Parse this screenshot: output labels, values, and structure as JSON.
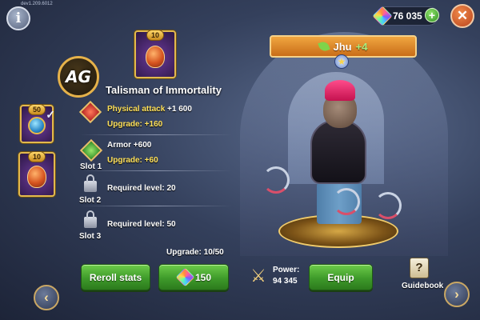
{
  "version": "dev1.209.6012",
  "top_bar": {
    "currency_value": "76 035",
    "currency_icon": "gem-icon",
    "plus_label": "+",
    "close_label": "✕",
    "info_label": "i"
  },
  "logo": {
    "text": "AG"
  },
  "item_cards": [
    {
      "level": "10",
      "icon": "talisman-heart-icon"
    },
    {
      "level": "50",
      "icon": "amulet-gem-icon",
      "equipped": true
    },
    {
      "level": "10",
      "icon": "talisman-heart-icon"
    }
  ],
  "item_panel": {
    "title": "Talisman of Immortality",
    "stats": [
      {
        "label": "Physical attack",
        "value": "+1 600",
        "upgrade": "Upgrade: +160",
        "icon": "attack-diamond-icon",
        "slot": ""
      },
      {
        "label": "Armor",
        "value": "+600",
        "upgrade": "Upgrade: +60",
        "icon": "armor-diamond-icon",
        "slot": "Slot 1"
      },
      {
        "label": "Required level: 20",
        "slot": "Slot 2",
        "icon": "lock-icon"
      },
      {
        "label": "Required level: 50",
        "slot": "Slot 3",
        "icon": "lock-icon"
      }
    ],
    "upgrade_count": "Upgrade: 10/50",
    "reroll_label": "Reroll stats",
    "cost_value": "150"
  },
  "hero": {
    "name": "Jhu",
    "level_bonus": "+4",
    "stars": "★"
  },
  "power": {
    "label": "Power:",
    "value": "94 345"
  },
  "equip_label": "Equip",
  "guidebook": {
    "label": "Guidebook",
    "icon_glyph": "?"
  },
  "nav": {
    "prev": "‹",
    "next": "›"
  },
  "colors": {
    "accent_gold": "#e2b94e",
    "button_green": "#3e9a2a",
    "stat_yellow": "#ffe15a",
    "banner_orange": "#e08a2c"
  }
}
